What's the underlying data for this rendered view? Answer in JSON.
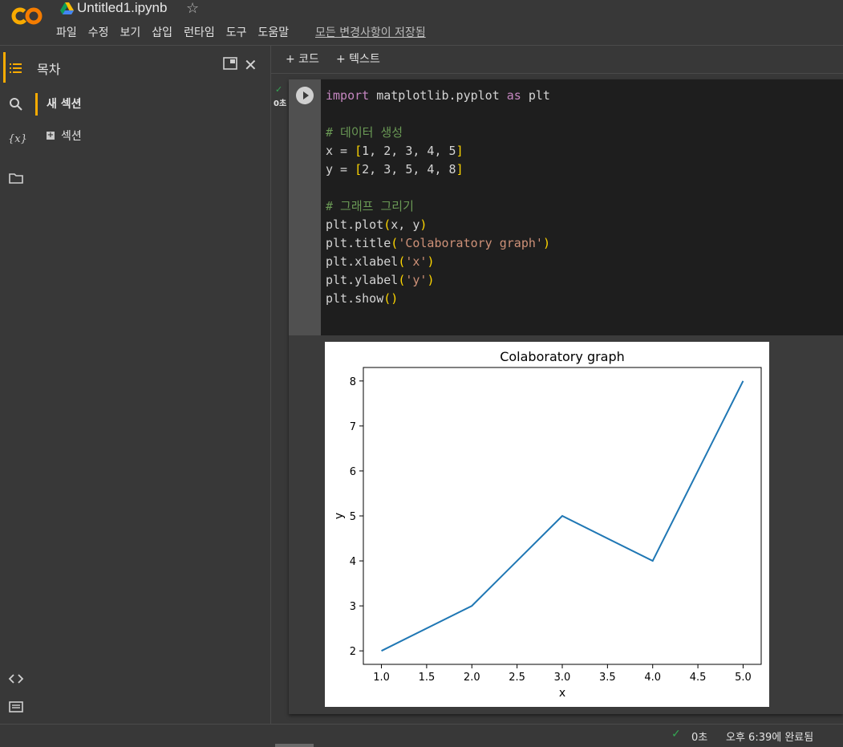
{
  "header": {
    "doc_title": "Untitled1.ipynb",
    "menu": [
      "파일",
      "수정",
      "보기",
      "삽입",
      "런타임",
      "도구",
      "도움말"
    ],
    "saved_status": "모든 변경사항이 저장됨"
  },
  "rail": {
    "icons": [
      "toc-icon",
      "search-icon",
      "variables-icon",
      "folder-icon",
      "code-snippets-icon",
      "terminal-icon"
    ],
    "variables_label": "{x}"
  },
  "toc": {
    "title": "목차",
    "active_item": "새 섹션",
    "sub_item": "섹션"
  },
  "toolbar": {
    "add_code": "+ 코드",
    "add_text": "+ 텍스트"
  },
  "cell": {
    "exec_time": "0초",
    "code_lines": [
      "import matplotlib.pyplot as plt",
      "",
      "# 데이터 생성",
      "x = [1, 2, 3, 4, 5]",
      "y = [2, 3, 5, 4, 8]",
      "",
      "# 그래프 그리기",
      "plt.plot(x, y)",
      "plt.title('Colaboratory graph')",
      "plt.xlabel('x')",
      "plt.ylabel('y')",
      "plt.show()"
    ]
  },
  "chart_data": {
    "type": "line",
    "title": "Colaboratory graph",
    "xlabel": "x",
    "ylabel": "y",
    "x": [
      1,
      2,
      3,
      4,
      5
    ],
    "series": [
      {
        "values": [
          2,
          3,
          5,
          4,
          8
        ],
        "color": "#1f77b4"
      }
    ],
    "xlim": [
      0.8,
      5.2
    ],
    "ylim": [
      1.7,
      8.3
    ],
    "xticks": [
      "1.0",
      "1.5",
      "2.0",
      "2.5",
      "3.0",
      "3.5",
      "4.0",
      "4.5",
      "5.0"
    ],
    "yticks": [
      "2",
      "3",
      "4",
      "5",
      "6",
      "7",
      "8"
    ],
    "grid": false
  },
  "status": {
    "time": "0초",
    "done": "오후 6:39에 완료됨"
  },
  "colors": {
    "accent": "#f9ab00",
    "success": "#34a853",
    "line": "#1f77b4"
  }
}
